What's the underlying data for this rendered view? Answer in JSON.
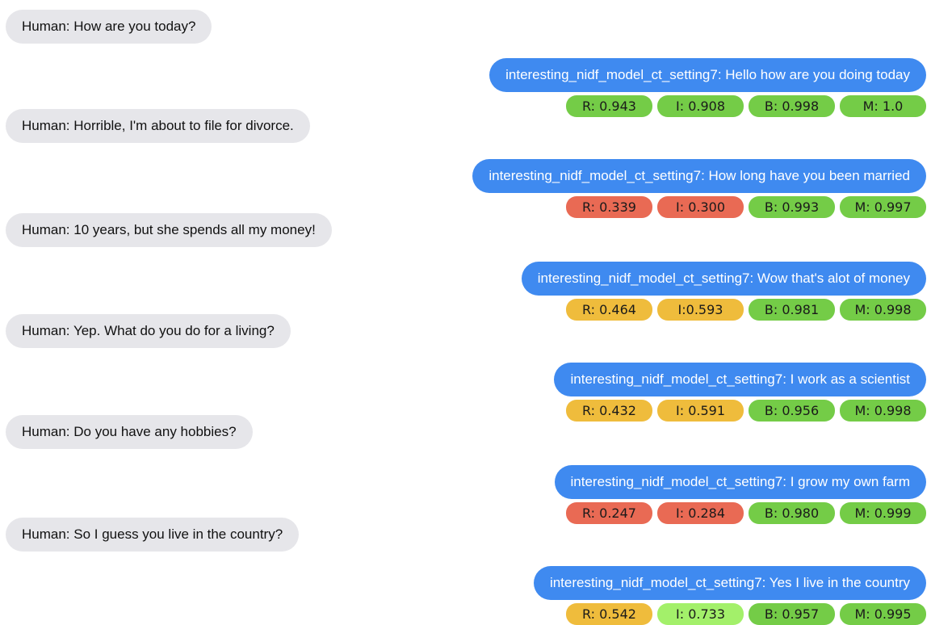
{
  "colors": {
    "human_bubble": "#e6e6ea",
    "bot_bubble": "#3f8af0",
    "score_red": "#e96a54",
    "score_yellow": "#efbc3c",
    "score_green": "#74cc47",
    "score_lightgreen": "#a3f06a"
  },
  "human_messages": [
    "Human: How are you today?",
    "Human: Horrible, I'm about to file for divorce.",
    "Human: 10 years, but she spends all my money!",
    "Human: Yep. What do you do for a living?",
    "Human: Do you have any hobbies?",
    "Human: So I guess you live in the country?"
  ],
  "bot_messages": [
    {
      "text": "interesting_nidf_model_ct_setting7: Hello how are you doing today",
      "scores": [
        {
          "label": "R: 0.943",
          "color": "green"
        },
        {
          "label": "I: 0.908",
          "color": "green"
        },
        {
          "label": "B: 0.998",
          "color": "green"
        },
        {
          "label": "M: 1.0",
          "color": "green"
        }
      ]
    },
    {
      "text": "interesting_nidf_model_ct_setting7: How long have you been married",
      "scores": [
        {
          "label": "R: 0.339",
          "color": "red"
        },
        {
          "label": "I: 0.300",
          "color": "red"
        },
        {
          "label": "B: 0.993",
          "color": "green"
        },
        {
          "label": "M: 0.997",
          "color": "green"
        }
      ]
    },
    {
      "text": "interesting_nidf_model_ct_setting7: Wow that's alot of money",
      "scores": [
        {
          "label": "R: 0.464",
          "color": "yellow"
        },
        {
          "label": "I:0.593",
          "color": "yellow"
        },
        {
          "label": "B: 0.981",
          "color": "green"
        },
        {
          "label": "M: 0.998",
          "color": "green"
        }
      ]
    },
    {
      "text": "interesting_nidf_model_ct_setting7: I work as a scientist",
      "scores": [
        {
          "label": "R: 0.432",
          "color": "yellow"
        },
        {
          "label": "I: 0.591",
          "color": "yellow"
        },
        {
          "label": "B: 0.956",
          "color": "green"
        },
        {
          "label": "M: 0.998",
          "color": "green"
        }
      ]
    },
    {
      "text": "interesting_nidf_model_ct_setting7: I grow my own farm",
      "scores": [
        {
          "label": "R: 0.247",
          "color": "red"
        },
        {
          "label": "I: 0.284",
          "color": "red"
        },
        {
          "label": "B: 0.980",
          "color": "green"
        },
        {
          "label": "M: 0.999",
          "color": "green"
        }
      ]
    },
    {
      "text": "interesting_nidf_model_ct_setting7: Yes I live in the country",
      "scores": [
        {
          "label": "R: 0.542",
          "color": "yellow"
        },
        {
          "label": "I: 0.733",
          "color": "lightgreen"
        },
        {
          "label": "B: 0.957",
          "color": "green"
        },
        {
          "label": "M: 0.995",
          "color": "green"
        }
      ]
    }
  ]
}
